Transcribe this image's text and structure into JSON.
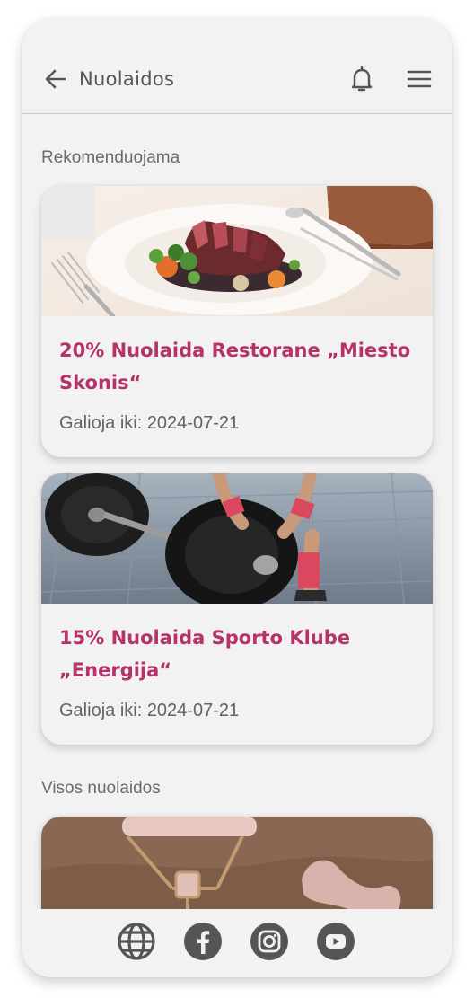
{
  "header": {
    "title": "Nuolaidos",
    "back_icon": "arrow-left-icon",
    "notification_icon": "bell-icon",
    "menu_icon": "hamburger-menu-icon"
  },
  "sections": {
    "recommended_title": "Rekomenduojama",
    "all_title": "Visos nuolaidos"
  },
  "recommended": [
    {
      "title": "20% Nuolaida Restorane „Miesto Skonis“",
      "valid_until": "Galioja iki: 2024-07-21",
      "image": "steak-dinner-plate"
    },
    {
      "title": "15% Nuolaida Sporto Klube „Energija“",
      "valid_until": "Galioja iki: 2024-07-21",
      "image": "barbell-weight-plates"
    }
  ],
  "all_discounts": [
    {
      "image": "rose-quartz-face-roller"
    }
  ],
  "footer": {
    "social_icons": [
      "globe-icon",
      "facebook-icon",
      "instagram-icon",
      "youtube-icon"
    ]
  },
  "colors": {
    "accent": "#b5336a",
    "background": "#f2f2f2",
    "text_muted": "#636363",
    "icon": "#555555"
  }
}
